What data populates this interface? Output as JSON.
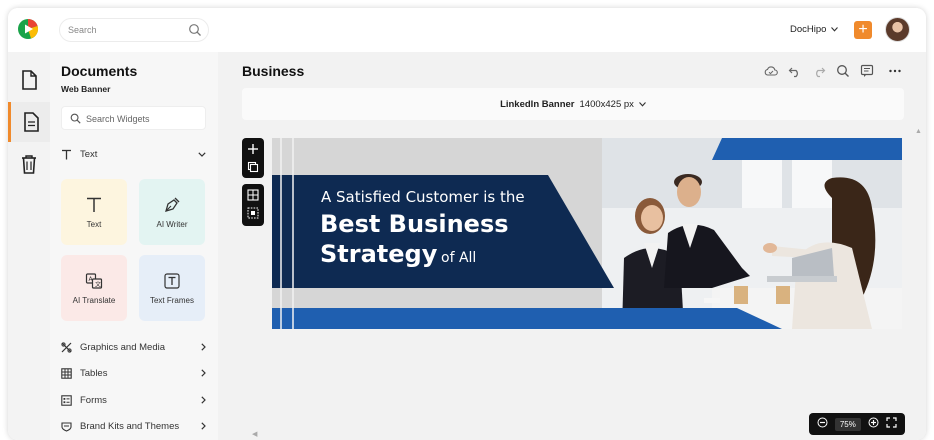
{
  "topbar": {
    "search_placeholder": "Search",
    "user_name": "DocHipo"
  },
  "panel": {
    "title": "Documents",
    "subtitle": "Web Banner",
    "search_placeholder": "Search Widgets",
    "section_text": "Text",
    "cards": [
      {
        "label": "Text",
        "icon": "text-t-icon",
        "bg": "#fdf5df"
      },
      {
        "label": "AI Writer",
        "icon": "pen-nib-icon",
        "bg": "#e3f4f2"
      },
      {
        "label": "AI Translate",
        "icon": "translate-icon",
        "bg": "#fbe9e7"
      },
      {
        "label": "Text Frames",
        "icon": "text-frame-icon",
        "bg": "#e6eef8"
      }
    ],
    "categories": [
      {
        "label": "Graphics and Media",
        "icon": "graphics-icon"
      },
      {
        "label": "Tables",
        "icon": "table-icon"
      },
      {
        "label": "Forms",
        "icon": "form-icon"
      },
      {
        "label": "Brand Kits and Themes",
        "icon": "brand-kit-icon"
      }
    ]
  },
  "main": {
    "doc_title": "Business",
    "size_name": "LinkedIn Banner",
    "size_dims": "1400x425 px",
    "zoom": "75%"
  },
  "banner": {
    "line1": "A Satisfied Customer is the",
    "line2": "Best Business",
    "line3a": "Strategy",
    "line3b": "of All"
  },
  "colors": {
    "accent": "#f08a2c",
    "navy": "#0e2a52",
    "blue": "#1f5fb0"
  }
}
